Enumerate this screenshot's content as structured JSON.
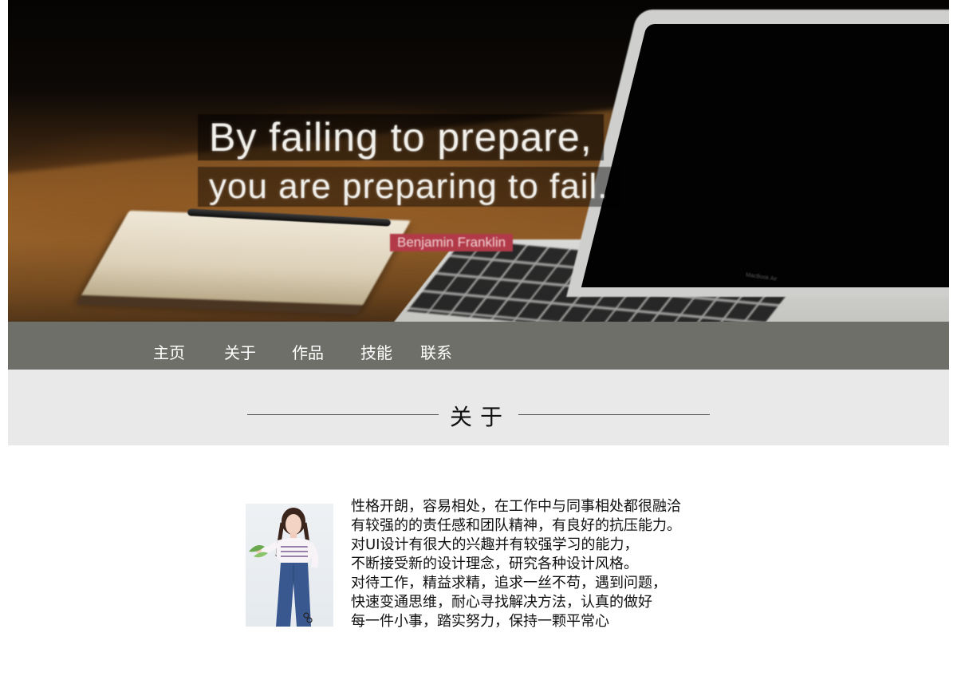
{
  "hero": {
    "quote_line1": "By failing to prepare,",
    "quote_line2": "you are preparing to fail.",
    "author": "Benjamin Franklin",
    "laptop_label": "MacBook Air"
  },
  "nav": {
    "items": [
      {
        "label": "主页"
      },
      {
        "label": "关于"
      },
      {
        "label": "作品"
      },
      {
        "label": "技能"
      },
      {
        "label": "联系"
      }
    ]
  },
  "section": {
    "title": "关于"
  },
  "about": {
    "lines": [
      "性格开朗，容易相处，在工作中与同事相处都很融洽",
      "有较强的的责任感和团队精神，有良好的抗压能力。",
      "对UI设计有很大的兴趣并有较强学习的能力，",
      "不断接受新的设计理念，研究各种设计风格。",
      "对待工作，精益求精，追求一丝不苟，遇到问题，",
      "快速变通思维，耐心寻找解决方法，认真的做好",
      "每一件小事，踏实努力，保持一颗平常心"
    ]
  },
  "colors": {
    "nav_bg": "#6f6f69",
    "section_bg": "#e9e9e9",
    "author_badge": "#b23a48"
  }
}
